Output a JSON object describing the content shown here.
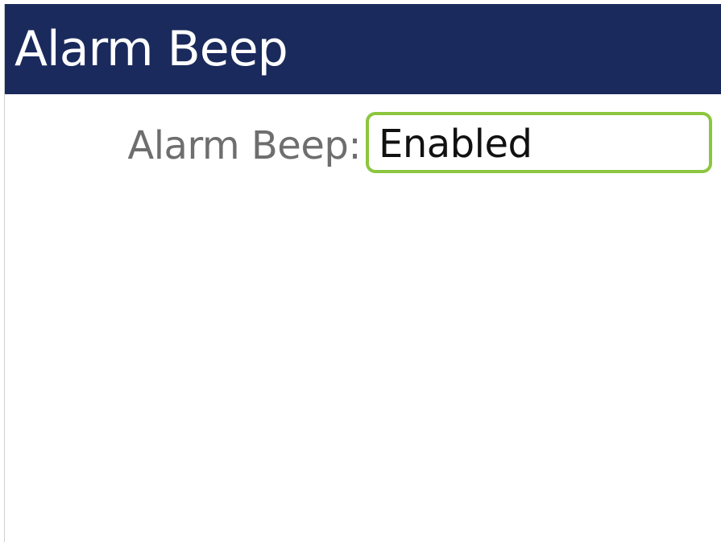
{
  "header": {
    "title": "Alarm Beep"
  },
  "setting": {
    "label": "Alarm Beep:",
    "value": "Enabled"
  },
  "colors": {
    "title_bar": "#1b2a5c",
    "title_text": "#ffffff",
    "label_text": "#6e6e6e",
    "value_text": "#111111",
    "focus_border": "#8cc63f"
  }
}
